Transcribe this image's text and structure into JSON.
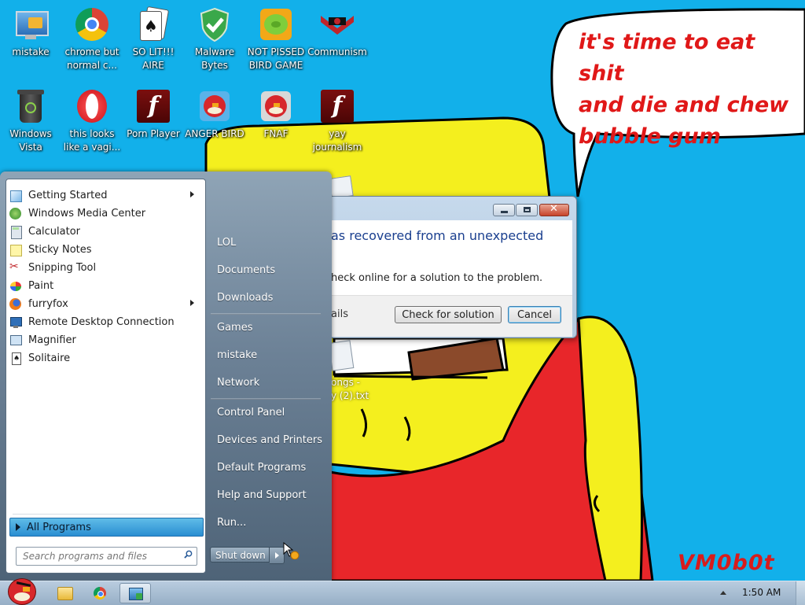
{
  "desktop": {
    "icons": [
      {
        "label": "mistake",
        "icon": "computer-folder-icon"
      },
      {
        "label": "chrome but normal c...",
        "icon": "chrome-icon"
      },
      {
        "label": "SO LIT!!! AIRE",
        "icon": "solitaire-icon"
      },
      {
        "label": "Malware Bytes",
        "icon": "shield-icon"
      },
      {
        "label": "NOT PISSED BIRD GAME",
        "icon": "pig-icon"
      },
      {
        "label": "Communism",
        "icon": "emblem-icon"
      },
      {
        "label": "Windows Vista",
        "icon": "recycle-bin-icon"
      },
      {
        "label": "this looks like a vagi...",
        "icon": "opera-icon"
      },
      {
        "label": "Porn Player",
        "icon": "flash-icon"
      },
      {
        "label": "ANGER BIRD",
        "icon": "angry-bird-icon"
      },
      {
        "label": "FNAF",
        "icon": "angry-bird-icon"
      },
      {
        "label": "yay journalism",
        "icon": "flash-icon"
      }
    ],
    "wallpaper": {
      "speech_text": "it's time to eat shit\nand die and chew\nbubble gum",
      "watermark": "VM0b0t",
      "file_fragment_1": "ongs -",
      "file_fragment_2": "y (2).txt"
    }
  },
  "start_menu": {
    "programs": [
      {
        "label": "Getting Started",
        "icon": "getting-started-icon",
        "submenu": true
      },
      {
        "label": "Windows Media Center",
        "icon": "media-center-icon",
        "submenu": false
      },
      {
        "label": "Calculator",
        "icon": "calculator-icon",
        "submenu": false
      },
      {
        "label": "Sticky Notes",
        "icon": "sticky-notes-icon",
        "submenu": false
      },
      {
        "label": "Snipping Tool",
        "icon": "scissors-icon",
        "submenu": false
      },
      {
        "label": "Paint",
        "icon": "paint-icon",
        "submenu": false
      },
      {
        "label": "furryfox",
        "icon": "firefox-icon",
        "submenu": true
      },
      {
        "label": "Remote Desktop Connection",
        "icon": "remote-desktop-icon",
        "submenu": false
      },
      {
        "label": "Magnifier",
        "icon": "magnifier-icon",
        "submenu": false
      },
      {
        "label": "Solitaire",
        "icon": "solitaire-icon",
        "submenu": false
      }
    ],
    "all_programs": "All Programs",
    "search_placeholder": "Search programs and files",
    "right_items": [
      "LOL",
      "Documents",
      "Downloads",
      "Games",
      "mistake",
      "Network",
      "Control Panel",
      "Devices and Printers",
      "Default Programs",
      "Help and Support",
      "Run..."
    ],
    "shutdown_label": "Shut down"
  },
  "dialog": {
    "heading": "as recovered from an unexpected",
    "text": "heck online for a solution to the problem.",
    "details": "ails",
    "check_button": "Check for solution",
    "cancel_button": "Cancel"
  },
  "taskbar": {
    "clock": "1:50 AM",
    "buttons": [
      "angry-bird-start-icon",
      "folder-icon",
      "chrome-icon",
      "app-icon"
    ]
  },
  "colors": {
    "desktop_bg": "#12b0ea",
    "speech_red": "#e01818",
    "shirt_red": "#e8262a",
    "face_yellow": "#f4ef1e",
    "all_programs_blue": "#2a8ed2",
    "dialog_heading": "#1a3f8f"
  }
}
